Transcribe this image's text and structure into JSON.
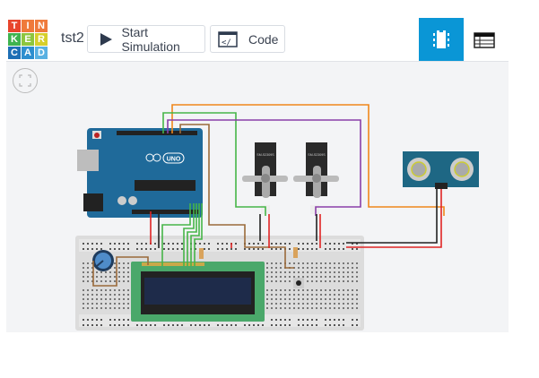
{
  "logo": {
    "letters": [
      "T",
      "I",
      "N",
      "K",
      "E",
      "R",
      "C",
      "A",
      "D"
    ],
    "colors": [
      "#e8452c",
      "#ef7a3b",
      "#ef7a3b",
      "#3fb34f",
      "#8dc63f",
      "#d6cf2c",
      "#1e6fb5",
      "#2d8ecf",
      "#59b1e2"
    ]
  },
  "header": {
    "title": "tst2",
    "start_simulation": "Start Simulation",
    "code": "Code"
  },
  "views": {
    "active": "components",
    "accent": "#0a96d6"
  },
  "circuit": {
    "board": "Arduino UNO",
    "components": [
      "breadboard",
      "lcd-16x2",
      "potentiometer",
      "resistor",
      "resistor",
      "pushbutton",
      "servo",
      "servo",
      "ultrasonic-sensor"
    ],
    "board_badge": "UNO",
    "servo_label": "SM-S2309S"
  }
}
